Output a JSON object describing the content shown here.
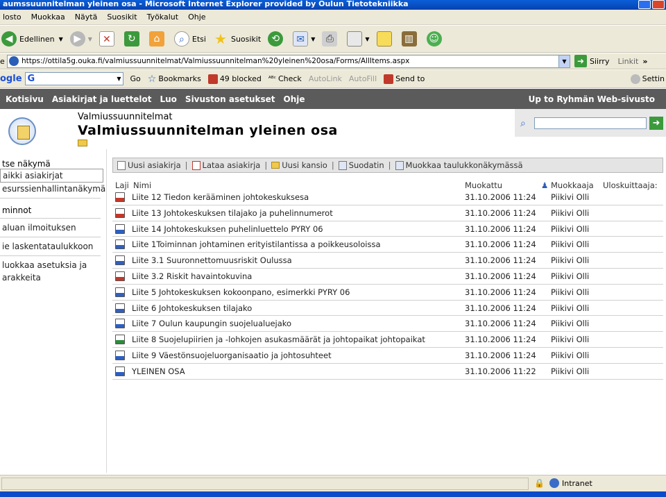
{
  "window": {
    "title": "aumssuunnitelman yleinen osa - Microsoft Internet Explorer provided by Oulun Tietotekniikka"
  },
  "menubar": [
    "losto",
    "Muokkaa",
    "Näytä",
    "Suosikit",
    "Työkalut",
    "Ohje"
  ],
  "toolbar": {
    "back_label": "Edellinen",
    "search_label": "Etsi",
    "favorites_label": "Suosikit"
  },
  "address": {
    "label": "e",
    "url": "https://ottila5g.ouka.fi/valmiussuunnitelmat/Valmiussuunnitelman%20yleinen%20osa/Forms/AllItems.aspx",
    "go_label": "Siirry",
    "links_label": "Linkit"
  },
  "googlebar": {
    "logo": "ogle",
    "go": "Go",
    "bookmarks": "Bookmarks",
    "blocked": "49 blocked",
    "check": "Check",
    "autolink": "AutoLink",
    "autofill": "AutoFill",
    "sendto": "Send to",
    "settings": "Settin"
  },
  "topnav": {
    "items": [
      "Kotisivu",
      "Asiakirjat ja luettelot",
      "Luo",
      "Sivuston asetukset",
      "Ohje"
    ],
    "right": "Up to Ryhmän Web-sivusto"
  },
  "header": {
    "site_title": "Valmiussuunnitelmat",
    "page_title": "Valmiussuunnitelman yleinen osa"
  },
  "leftnav": {
    "section1_title": "tse näkymä",
    "views": [
      "aikki asiakirjat",
      "esurssienhallintanäkymä"
    ],
    "section2_title": "minnot",
    "actions": [
      "aluan ilmoituksen",
      "ie laskentataulukkoon",
      "luokkaa asetuksia ja arakkeita"
    ]
  },
  "actionbar": {
    "new_doc": "Uusi asiakirja",
    "upload": "Lataa asiakirja",
    "new_folder": "Uusi kansio",
    "filter": "Suodatin",
    "datasheet": "Muokkaa taulukkonäkymässä"
  },
  "columns": {
    "type": "Laji",
    "name": "Nimi",
    "modified": "Muokattu",
    "modified_by": "Muokkaaja",
    "checked_out": "Uloskuittaaja:"
  },
  "documents": [
    {
      "type": "pdf",
      "name": "Liite 12 Tiedon kerääminen johtokeskuksesa",
      "date": "31.10.2006 11:24",
      "author": "Piikivi Olli"
    },
    {
      "type": "pdf",
      "name": "Liite 13 Johtokeskuksen tilajako ja puhelinnumerot",
      "date": "31.10.2006 11:24",
      "author": "Piikivi Olli"
    },
    {
      "type": "word",
      "name": "Liite 14 Johtokeskuksen puhelinluettelo PYRY 06",
      "date": "31.10.2006 11:24",
      "author": "Piikivi Olli"
    },
    {
      "type": "word",
      "name": "Liite 1Toiminnan johtaminen erityistilantissa a poikkeusoloissa",
      "date": "31.10.2006 11:24",
      "author": "Piikivi Olli"
    },
    {
      "type": "word",
      "name": "Liite 3.1 Suuronnettomuusriskit Oulussa",
      "date": "31.10.2006 11:24",
      "author": "Piikivi Olli"
    },
    {
      "type": "pdf",
      "name": "Liite 3.2 Riskit havaintokuvina",
      "date": "31.10.2006 11:24",
      "author": "Piikivi Olli"
    },
    {
      "type": "word",
      "name": "Liite 5 Johtokeskuksen kokoonpano, esimerkki PYRY 06",
      "date": "31.10.2006 11:24",
      "author": "Piikivi Olli"
    },
    {
      "type": "word",
      "name": "Liite 6 Johtokeskuksen tilajako",
      "date": "31.10.2006 11:24",
      "author": "Piikivi Olli"
    },
    {
      "type": "word",
      "name": "Liite 7 Oulun kaupungin suojelualuejako",
      "date": "31.10.2006 11:24",
      "author": "Piikivi Olli"
    },
    {
      "type": "xls",
      "name": "Liite 8 Suojelupiirien ja -lohkojen asukasmäärät ja johtopaikat johtopaikat",
      "date": "31.10.2006 11:24",
      "author": "Piikivi Olli"
    },
    {
      "type": "word",
      "name": "Liite 9 Väestönsuojeluorganisaatio ja johtosuhteet",
      "date": "31.10.2006 11:24",
      "author": "Piikivi Olli"
    },
    {
      "type": "word",
      "name": "YLEINEN OSA",
      "date": "31.10.2006 11:22",
      "author": "Piikivi Olli"
    }
  ],
  "status": {
    "zone": "Intranet"
  }
}
